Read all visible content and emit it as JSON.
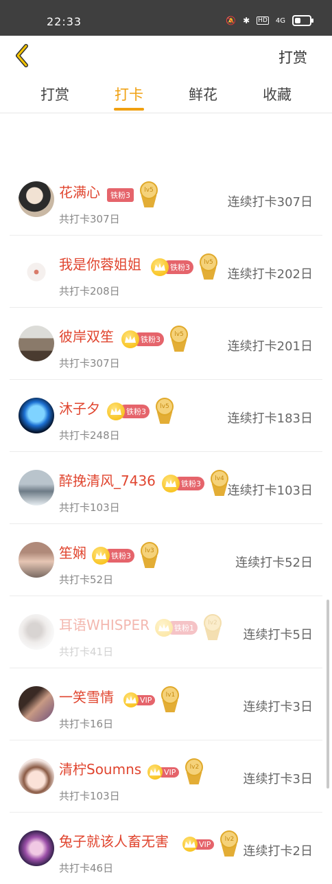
{
  "status": {
    "time": "22:33",
    "hd": "HD",
    "network": "4G"
  },
  "header": {
    "title": "打赏"
  },
  "tabs": [
    {
      "label": "打赏",
      "active": false
    },
    {
      "label": "打卡",
      "active": true
    },
    {
      "label": "鲜花",
      "active": false
    },
    {
      "label": "收藏",
      "active": false
    }
  ],
  "colors": {
    "accent": "#f0a010",
    "name": "#e0452f",
    "badge": "#e5646b"
  },
  "rows": [
    {
      "name": "花满心",
      "badge": "铁粉3",
      "badge_type": "fan_plain",
      "level": "lv5",
      "total": "共打卡307日",
      "streak": "连续打卡307日"
    },
    {
      "name": "我是你蓉姐姐",
      "badge": "铁粉3",
      "badge_type": "fan",
      "level": "lv5",
      "total": "共打卡208日",
      "streak": "连续打卡202日"
    },
    {
      "name": "彼岸双笙",
      "badge": "铁粉3",
      "badge_type": "fan",
      "level": "lv5",
      "total": "共打卡307日",
      "streak": "连续打卡201日"
    },
    {
      "name": "沐子夕",
      "badge": "铁粉3",
      "badge_type": "fan",
      "level": "lv5",
      "total": "共打卡248日",
      "streak": "连续打卡183日"
    },
    {
      "name": "醉挽清风_7436",
      "badge": "铁粉3",
      "badge_type": "fan",
      "level": "lv4",
      "total": "共打卡103日",
      "streak": "连续打卡103日"
    },
    {
      "name": "笙娴",
      "badge": "铁粉3",
      "badge_type": "fan",
      "level": "lv3",
      "total": "共打卡52日",
      "streak": "连续打卡52日"
    },
    {
      "name": "耳语WHISPER",
      "badge": "铁粉1",
      "badge_type": "fan",
      "level": "lv2",
      "total": "共打卡41日",
      "streak": "连续打卡5日",
      "faded": true
    },
    {
      "name": "一笑雪情",
      "badge": "VIP",
      "badge_type": "vip",
      "level": "lv1",
      "total": "共打卡16日",
      "streak": "连续打卡3日"
    },
    {
      "name": "清柠Soumns",
      "badge": "VIP",
      "badge_type": "vip",
      "level": "lv2",
      "total": "共打卡103日",
      "streak": "连续打卡3日"
    },
    {
      "name": "兔子就该人畜无害",
      "badge": "VIP",
      "badge_type": "vip",
      "level": "lv2",
      "total": "共打卡46日",
      "streak": "连续打卡2日"
    }
  ]
}
